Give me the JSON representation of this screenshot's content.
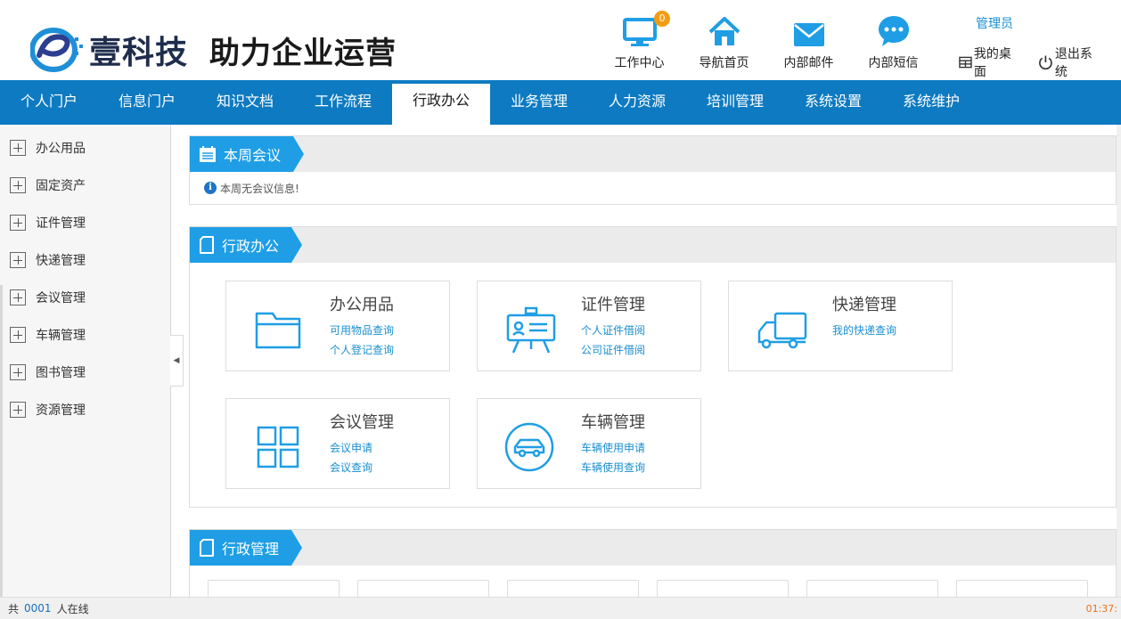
{
  "header": {
    "brand": "壹科技",
    "slogan": "助力企业运营",
    "tools": [
      {
        "label": "工作中心",
        "icon": "monitor-icon",
        "badge": "0"
      },
      {
        "label": "导航首页",
        "icon": "home-icon"
      },
      {
        "label": "内部邮件",
        "icon": "mail-icon"
      },
      {
        "label": "内部短信",
        "icon": "chat-icon"
      }
    ],
    "user": "管理员",
    "desktop_label": "我的桌面",
    "logout_label": "退出系统"
  },
  "nav": {
    "items": [
      "个人门户",
      "信息门户",
      "知识文档",
      "工作流程",
      "行政办公",
      "业务管理",
      "人力资源",
      "培训管理",
      "系统设置",
      "系统维护"
    ],
    "active_index": 4
  },
  "sidebar": {
    "items": [
      "办公用品",
      "固定资产",
      "证件管理",
      "快递管理",
      "会议管理",
      "车辆管理",
      "图书管理",
      "资源管理"
    ]
  },
  "meeting_panel": {
    "title": "本周会议",
    "empty_text": "本周无会议信息!"
  },
  "admin_panel": {
    "title": "行政办公",
    "cards": [
      {
        "title": "办公用品",
        "icon": "folder-icon",
        "links": [
          "可用物品查询",
          "个人登记查询"
        ]
      },
      {
        "title": "证件管理",
        "icon": "certificate-icon",
        "links": [
          "个人证件借阅",
          "公司证件借阅"
        ]
      },
      {
        "title": "快递管理",
        "icon": "truck-icon",
        "links": [
          "我的快递查询"
        ]
      },
      {
        "title": "会议管理",
        "icon": "grid-icon",
        "links": [
          "会议申请",
          "会议查询"
        ]
      },
      {
        "title": "车辆管理",
        "icon": "car-icon",
        "links": [
          "车辆使用申请",
          "车辆使用查询"
        ]
      }
    ]
  },
  "manage_panel": {
    "title": "行政管理"
  },
  "footer": {
    "prefix": "共",
    "count": "0001",
    "suffix": "人在线",
    "clock": "01:37:"
  },
  "colors": {
    "nav_bg": "#0d7ac2",
    "accent": "#1f9ee5",
    "link": "#1a8fd0",
    "badge": "#f39c12"
  }
}
